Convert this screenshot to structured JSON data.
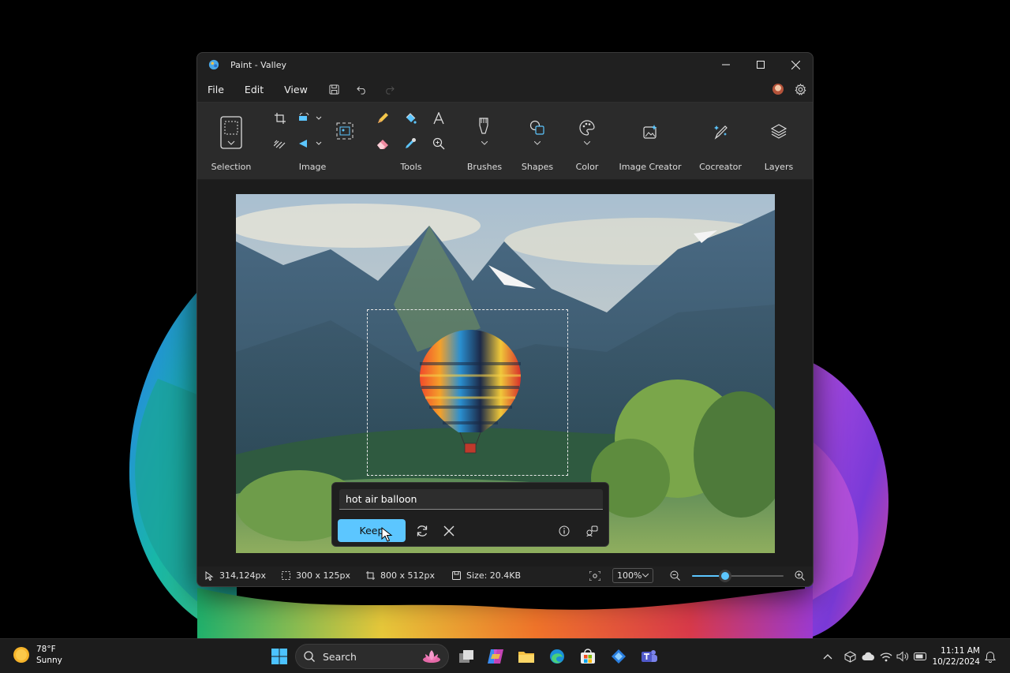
{
  "window": {
    "title": "Paint - Valley"
  },
  "menu": {
    "file": "File",
    "edit": "Edit",
    "view": "View"
  },
  "ribbon": {
    "selection": "Selection",
    "image": "Image",
    "tools": "Tools",
    "brushes": "Brushes",
    "shapes": "Shapes",
    "color": "Color",
    "image_creator": "Image Creator",
    "cocreator": "Cocreator",
    "layers": "Layers"
  },
  "prompt": {
    "value": "hot air balloon",
    "keep_label": "Keep"
  },
  "status": {
    "cursor": "314,124px",
    "selection_size": "300  x  125px",
    "canvas_size": "800  x  512px",
    "file_size": "Size: 20.4KB",
    "zoom": "100%",
    "zoom_slider_fraction": 0.36
  },
  "taskbar": {
    "weather_temp": "78°F",
    "weather_desc": "Sunny",
    "search_label": "Search",
    "time": "11:11 AM",
    "date": "10/22/2024"
  },
  "colors": {
    "accent": "#5cc6ff",
    "window_bg": "#202020",
    "ribbon_bg": "#2b2b2b"
  }
}
